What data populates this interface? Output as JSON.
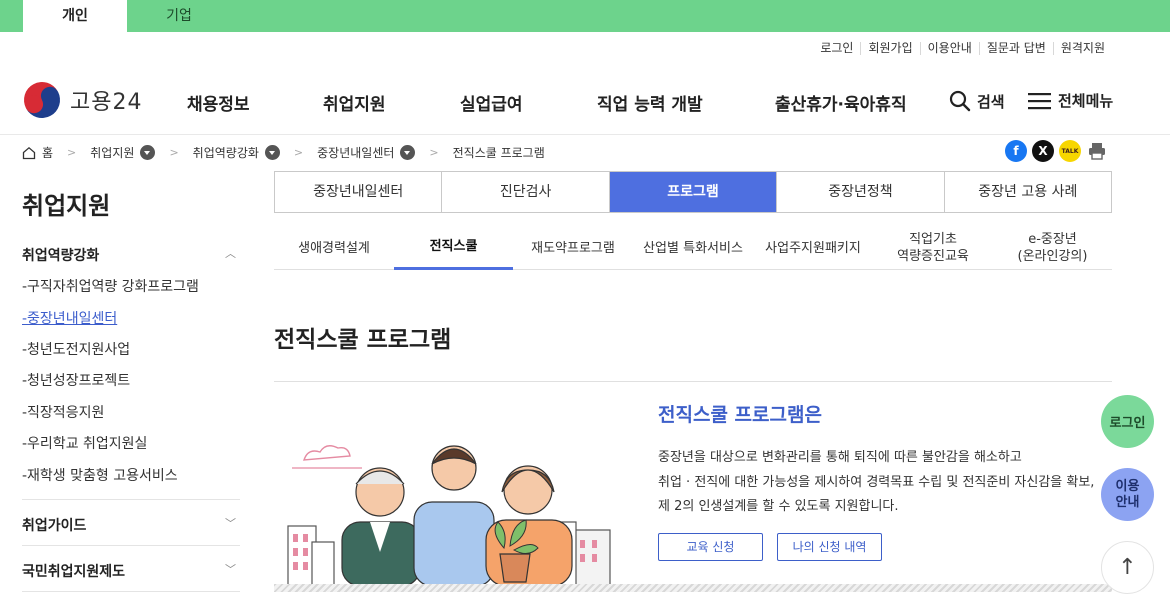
{
  "top_tabs": [
    {
      "label": "개인",
      "active": true
    },
    {
      "label": "기업",
      "active": false
    }
  ],
  "util_links": [
    "로그인",
    "회원가입",
    "이용안내",
    "질문과 답변",
    "원격지원"
  ],
  "logo": {
    "text": "고용24"
  },
  "gnb": [
    "채용정보",
    "취업지원",
    "실업급여",
    "직업 능력 개발",
    "출산휴가·육아휴직"
  ],
  "header_actions": {
    "search": "검색",
    "menu": "전체메뉴"
  },
  "breadcrumb": [
    "홈",
    "취업지원",
    "취업역량강화",
    "중장년내일센터",
    "전직스쿨 프로그램"
  ],
  "share_icons": [
    "facebook-icon",
    "x-icon",
    "kakaotalk-icon",
    "print-icon"
  ],
  "share_glyphs": {
    "facebook": "f",
    "x": "X",
    "kakao": "TALK"
  },
  "sidebar": {
    "title": "취업지원",
    "groups": [
      {
        "label": "취업역량강화",
        "open": true
      },
      {
        "label": "취업가이드",
        "open": false
      },
      {
        "label": "국민취업지원제도",
        "open": false
      }
    ],
    "items": [
      "-구직자취업역량 강화프로그램",
      "-중장년내일센터",
      "-청년도전지원사업",
      "-청년성장프로젝트",
      "-직장적응지원",
      "-우리학교 취업지원실",
      "-재학생 맞춤형 고용서비스"
    ],
    "current_item": "-중장년내일센터"
  },
  "tabs": [
    "중장년내일센터",
    "진단검사",
    "프로그램",
    "중장년정책",
    "중장년 고용 사례"
  ],
  "active_tab": "프로그램",
  "subtabs": [
    "생애경력설계",
    "전직스쿨",
    "재도약프로그램",
    "산업별 특화서비스",
    "사업주지원패키지",
    "직업기초\n역량증진교육",
    "e-중장년\n(온라인강의)"
  ],
  "active_subtab": "전직스쿨",
  "main": {
    "title": "전직스쿨 프로그램",
    "intro_title": "전직스쿨 프로그램은",
    "intro_lines": [
      "중장년을 대상으로 변화관리를 통해 퇴직에 따른 불안감을 해소하고",
      "취업 · 전직에 대한 가능성을 제시하여 경력목표 수립 및 전직준비 자신감을 확보,",
      "제 2의 인생설계를 할 수 있도록 지원합니다."
    ],
    "buttons": {
      "apply": "교육 신청",
      "history": "나의 신청 내역"
    }
  },
  "floating": {
    "login": "로그인",
    "guide_line1": "이용",
    "guide_line2": "안내",
    "top": "↑"
  },
  "colors": {
    "top_green": "#6dd38c",
    "accent_blue": "#4e6fe0",
    "link_blue": "#3d5fc9",
    "float_login": "#7bd99a",
    "float_guide": "#8ca3f2"
  }
}
